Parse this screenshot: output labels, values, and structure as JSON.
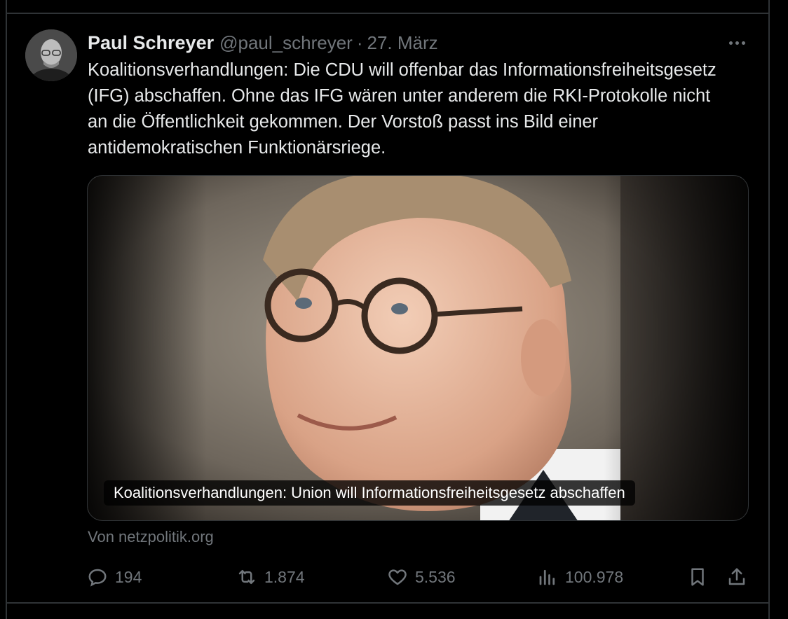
{
  "tweet": {
    "author_name": "Paul Schreyer",
    "handle": "@paul_schreyer",
    "separator": "·",
    "date": "27. März",
    "text": "Koalitionsverhandlungen: Die CDU will offenbar das Informationsfreiheitsgesetz (IFG) abschaffen. Ohne das IFG wären unter anderem die RKI-Protokolle nicht an die Öffentlichkeit gekommen. Der Vorstoß passt ins Bild einer antidemokratischen Funktionärsriege."
  },
  "card": {
    "title": "Koalitionsverhandlungen: Union will Informationsfreiheitsgesetz abschaffen",
    "source": "Von netzpolitik.org"
  },
  "actions": {
    "replies": "194",
    "reposts": "1.874",
    "likes": "5.536",
    "views": "100.978"
  },
  "icons": [
    "more-icon",
    "reply-icon",
    "repost-icon",
    "like-icon",
    "views-icon",
    "bookmark-icon",
    "share-icon"
  ],
  "colors": {
    "background": "#000000",
    "text": "#e7e9ea",
    "muted": "#71767b",
    "divider": "#2f3336"
  }
}
